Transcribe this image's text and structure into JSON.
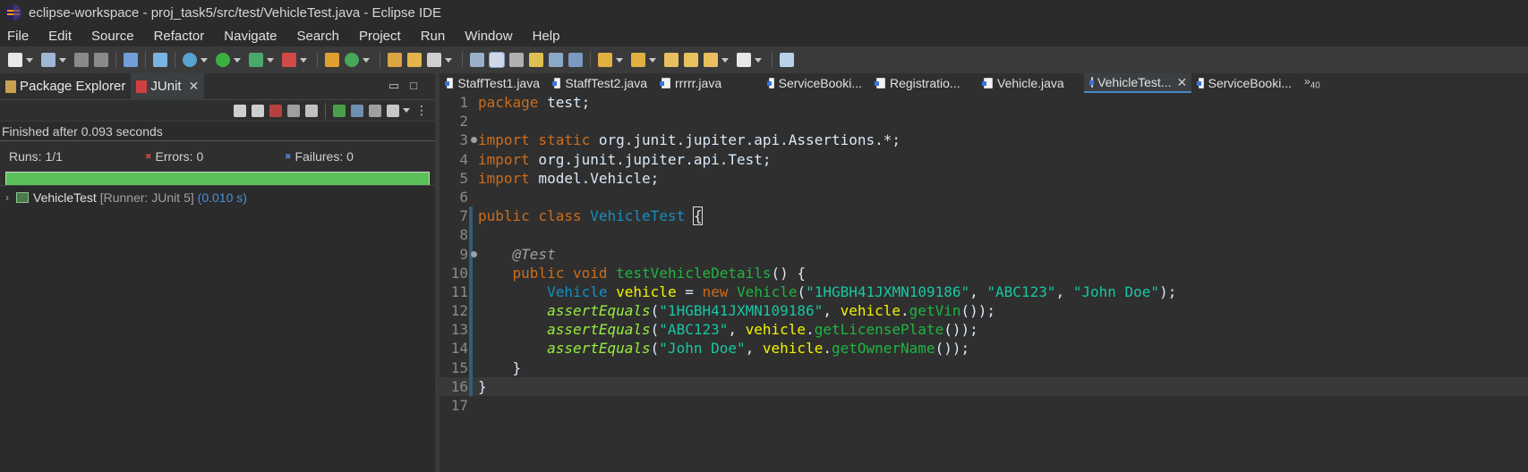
{
  "window": {
    "title": "eclipse-workspace - proj_task5/src/test/VehicleTest.java - Eclipse IDE"
  },
  "menu": [
    "File",
    "Edit",
    "Source",
    "Refactor",
    "Navigate",
    "Search",
    "Project",
    "Run",
    "Window",
    "Help"
  ],
  "left_panel": {
    "tabs": [
      {
        "label": "Package Explorer",
        "active": false
      },
      {
        "label": "JUnit",
        "active": true
      }
    ],
    "status": "Finished after 0.093 seconds",
    "runs_label": "Runs:",
    "runs_value": "1/1",
    "errors_label": "Errors:",
    "errors_value": "0",
    "failures_label": "Failures:",
    "failures_value": "0",
    "progress_fraction": 1.0,
    "progress_color": "#5ac05a",
    "tree": {
      "name": "VehicleTest",
      "runner": "[Runner: JUnit 5]",
      "time": "(0.010 s)"
    }
  },
  "editor": {
    "tabs": [
      {
        "label": "StaffTest1.java",
        "active": false
      },
      {
        "label": "StaffTest2.java",
        "active": false
      },
      {
        "label": "rrrrr.java",
        "active": false
      },
      {
        "label": "ServiceBooki...",
        "active": false
      },
      {
        "label": "Registratio...",
        "active": false
      },
      {
        "label": "Vehicle.java",
        "active": false
      },
      {
        "label": "VehicleTest...",
        "active": true
      },
      {
        "label": "ServiceBooki...",
        "active": false
      }
    ],
    "overflow": "»",
    "overflow_count": "40",
    "line_numbers": [
      "1",
      "2",
      "3",
      "4",
      "5",
      "6",
      "7",
      "8",
      "9",
      "10",
      "11",
      "12",
      "13",
      "14",
      "15",
      "16",
      "17"
    ]
  },
  "code": {
    "l1_kw": "package",
    "l1_rest": " test;",
    "l3_kw": "import static",
    "l3_rest": " org.junit.jupiter.api.Assertions.*;",
    "l4_kw": "import",
    "l4_rest": " org.junit.jupiter.api.Test;",
    "l5_kw": "import",
    "l5_rest": " model.Vehicle;",
    "l7_kw": "public class",
    "l7_sp": " ",
    "l7_cls": "VehicleTest",
    "l7_sp2": " ",
    "l7_brace": "{",
    "l9_ind": "    ",
    "l9_ann": "@Test",
    "l10_ind": "    ",
    "l10_kw": "public void",
    "l10_sp": " ",
    "l10_m": "testVehicleDetails",
    "l10_rest": "() {",
    "l11_ind": "        ",
    "l11_type": "Vehicle",
    "l11_sp": " ",
    "l11_var": "vehicle",
    "l11_eq": " = ",
    "l11_new": "new",
    "l11_sp2": " ",
    "l11_cls": "Vehicle",
    "l11_p1": "(",
    "l11_s1": "\"1HGBH41JXMN109186\"",
    "l11_c1": ", ",
    "l11_s2": "\"ABC123\"",
    "l11_c2": ", ",
    "l11_s3": "\"John Doe\"",
    "l11_end": ");",
    "l12_ind": "        ",
    "l12_m": "assertEquals",
    "l12_p": "(",
    "l12_s": "\"1HGBH41JXMN109186\"",
    "l12_c": ", ",
    "l12_v": "vehicle",
    "l12_dot": ".",
    "l12_g": "getVin",
    "l12_end": "());",
    "l13_ind": "        ",
    "l13_m": "assertEquals",
    "l13_p": "(",
    "l13_s": "\"ABC123\"",
    "l13_c": ", ",
    "l13_v": "vehicle",
    "l13_dot": ".",
    "l13_g": "getLicensePlate",
    "l13_end": "());",
    "l14_ind": "        ",
    "l14_m": "assertEquals",
    "l14_p": "(",
    "l14_s": "\"John Doe\"",
    "l14_c": ", ",
    "l14_v": "vehicle",
    "l14_dot": ".",
    "l14_g": "getOwnerName",
    "l14_end": "());",
    "l15": "    }",
    "l16": "}"
  }
}
